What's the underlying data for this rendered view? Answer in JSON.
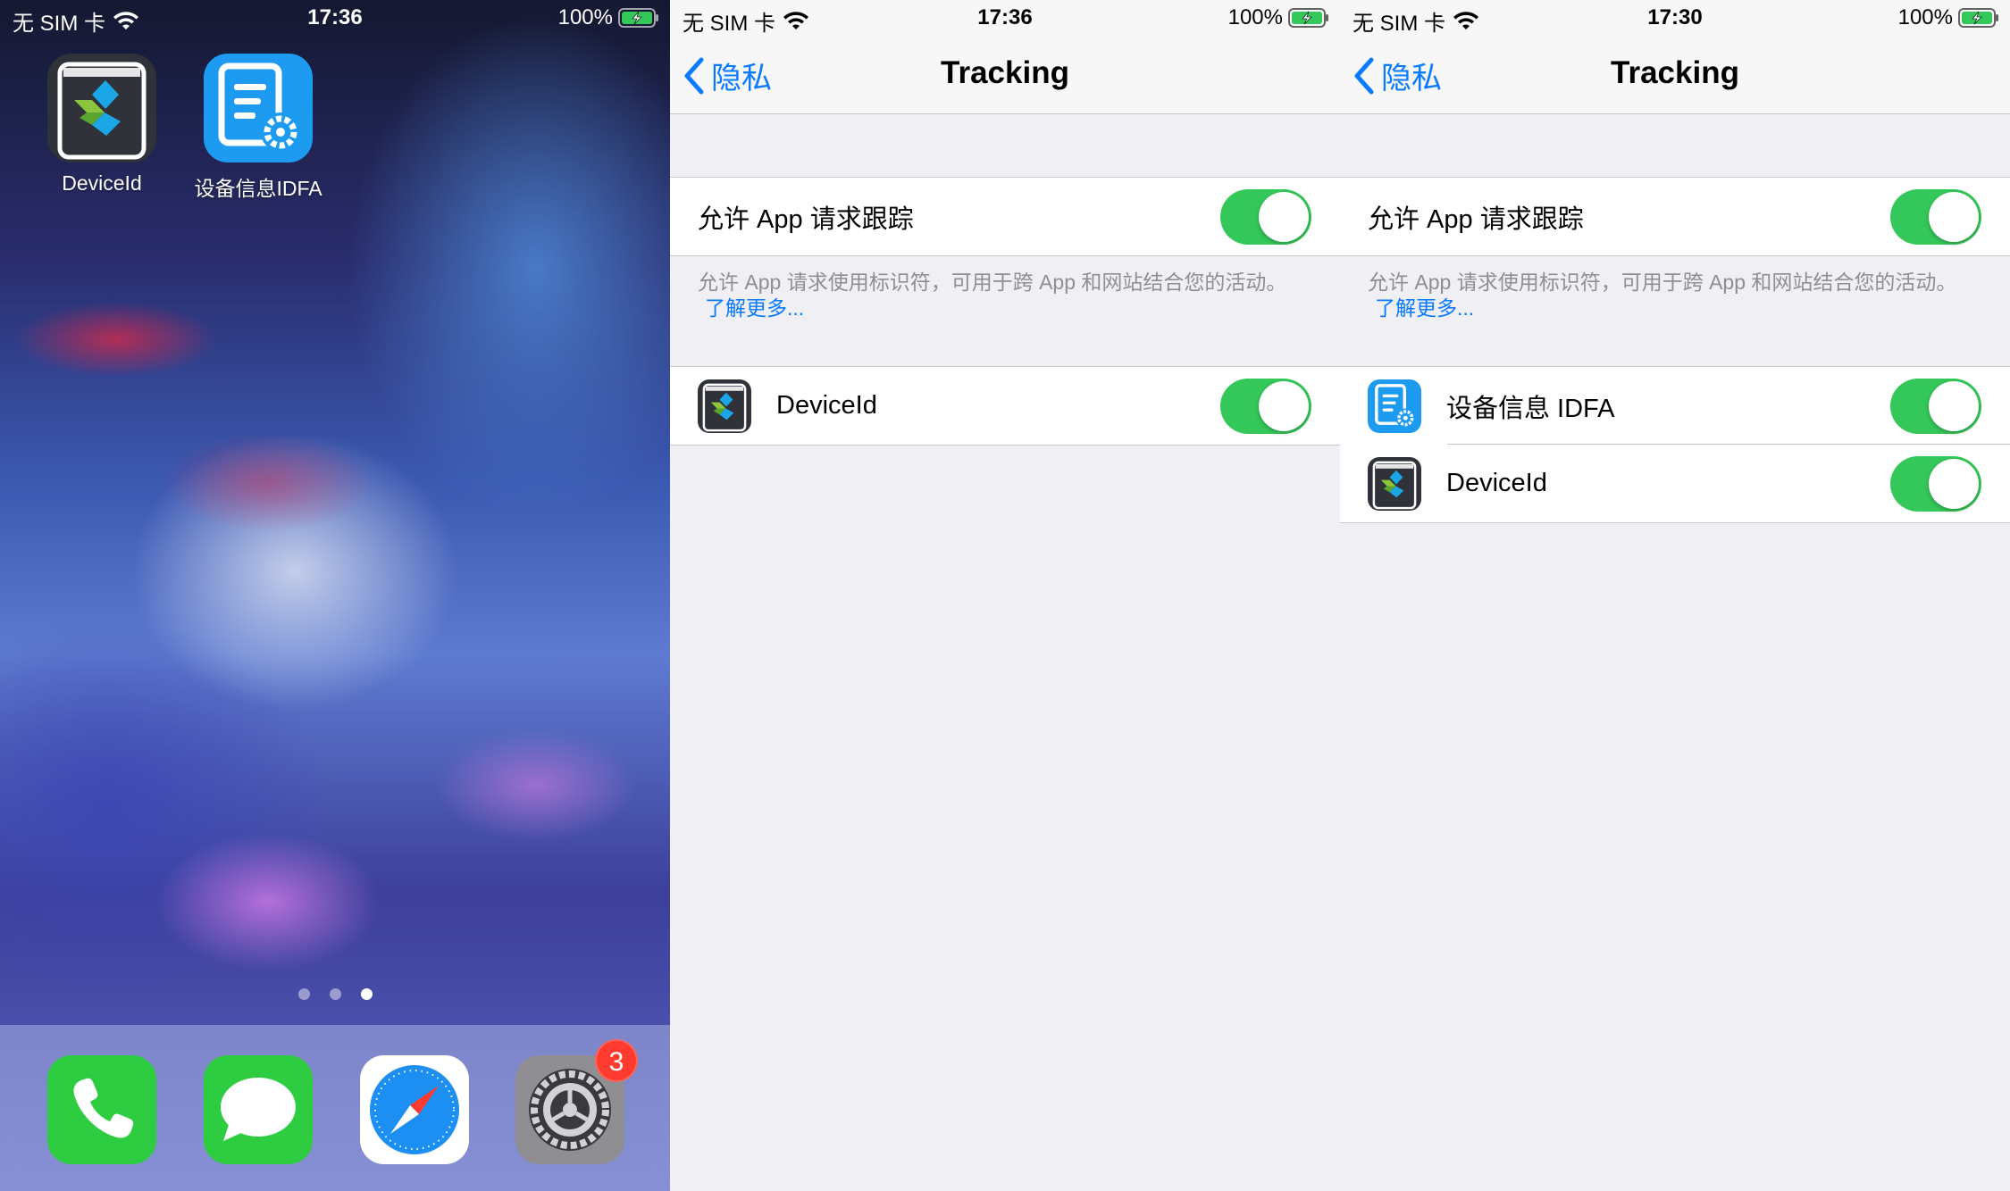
{
  "screens": [
    {
      "status": {
        "carrier": "无 SIM 卡",
        "time": "17:36",
        "battery": "100%"
      },
      "apps": [
        {
          "label": "DeviceId",
          "icon": "deviceid-app-icon"
        },
        {
          "label": "设备信息IDFA",
          "icon": "idfa-app-icon"
        }
      ],
      "page_dots": {
        "count": 3,
        "active": 3
      },
      "dock": [
        {
          "name": "phone-app-icon"
        },
        {
          "name": "messages-app-icon"
        },
        {
          "name": "safari-app-icon"
        },
        {
          "name": "settings-app-icon",
          "badge": "3"
        }
      ]
    },
    {
      "status": {
        "carrier": "无 SIM 卡",
        "time": "17:36",
        "battery": "100%"
      },
      "nav": {
        "back": "隐私",
        "title": "Tracking"
      },
      "allow": {
        "label": "允许 App 请求跟踪",
        "on": true
      },
      "footer": {
        "text": "允许 App 请求使用标识符，可用于跨 App 和网站结合您的活动。",
        "link": "了解更多..."
      },
      "apps": [
        {
          "label": "DeviceId",
          "icon": "deviceid-app-icon",
          "on": true
        }
      ]
    },
    {
      "status": {
        "carrier": "无 SIM 卡",
        "time": "17:30",
        "battery": "100%"
      },
      "nav": {
        "back": "隐私",
        "title": "Tracking"
      },
      "allow": {
        "label": "允许 App 请求跟踪",
        "on": true
      },
      "footer": {
        "text": "允许 App 请求使用标识符，可用于跨 App 和网站结合您的活动。",
        "link": "了解更多..."
      },
      "apps": [
        {
          "label": "设备信息 IDFA",
          "icon": "idfa-app-icon",
          "on": true
        },
        {
          "label": "DeviceId",
          "icon": "deviceid-app-icon",
          "on": true
        }
      ]
    }
  ],
  "colors": {
    "tint": "#0a7aff",
    "toggle_on": "#34c759",
    "badge": "#ff3b30",
    "grouped_bg": "#efeff4"
  }
}
